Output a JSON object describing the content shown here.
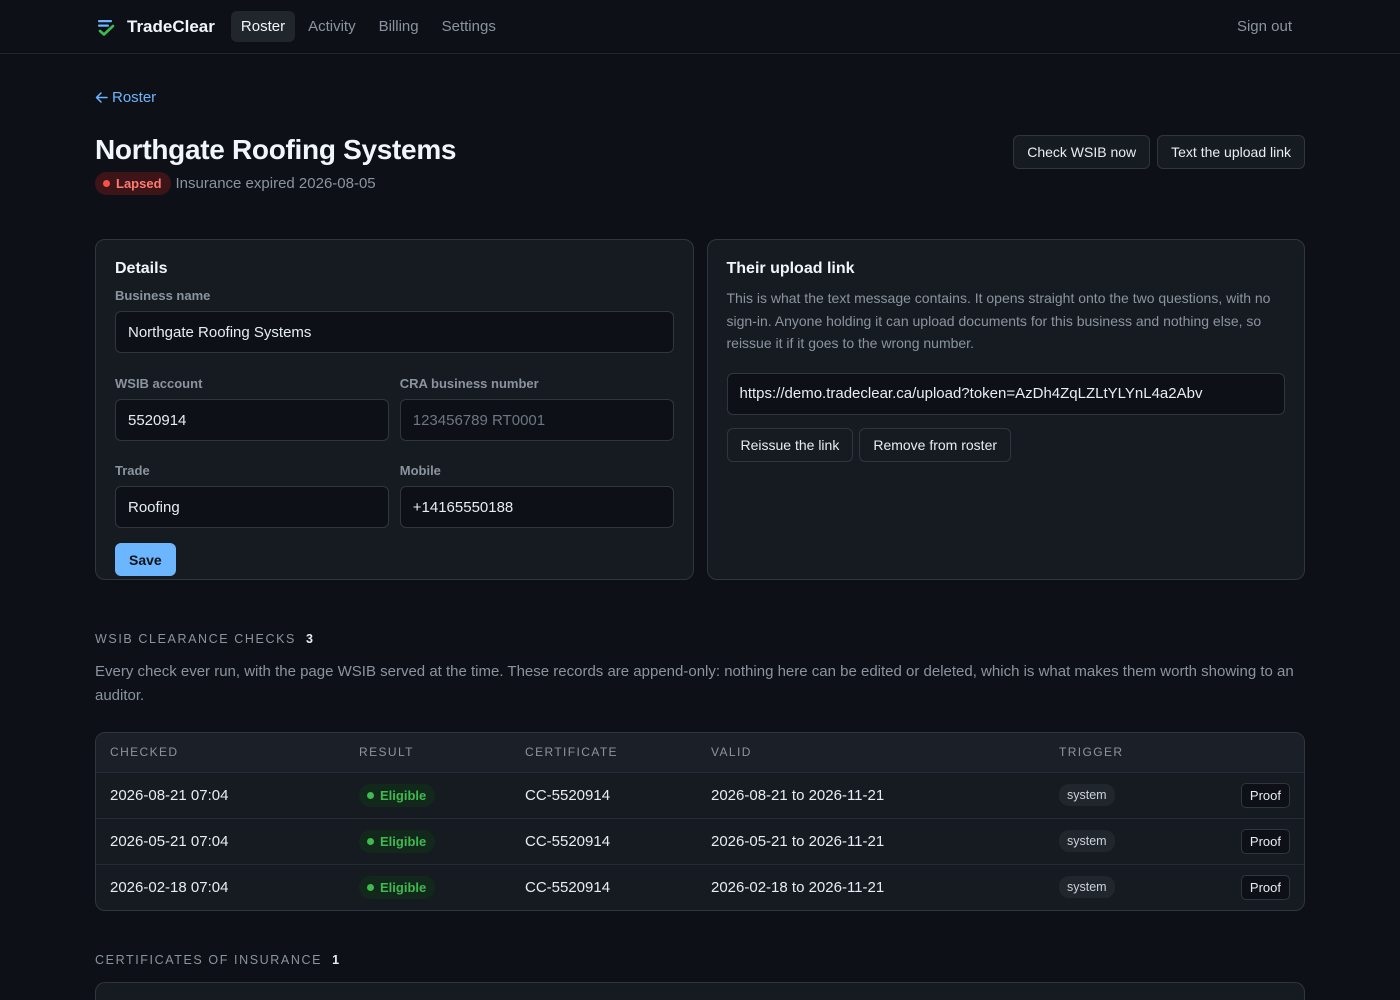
{
  "app": {
    "brand": "TradeClear",
    "nav": [
      "Roster",
      "Activity",
      "Billing",
      "Settings"
    ],
    "sign_out": "Sign out"
  },
  "page": {
    "back_label": "Roster",
    "title": "Northgate Roofing Systems",
    "status_badge": "Lapsed",
    "status_text": "Insurance expired 2026-08-05",
    "actions": [
      "Check WSIB now",
      "Text the upload link"
    ]
  },
  "details": {
    "title": "Details",
    "business_name_label": "Business name",
    "business_name": "Northgate Roofing Systems",
    "wsib_label": "WSIB account",
    "wsib": "5520914",
    "cra_label": "CRA business number",
    "cra_placeholder": "123456789 RT0001",
    "trade_label": "Trade",
    "trade": "Roofing",
    "mobile_label": "Mobile",
    "mobile": "+14165550188",
    "save_label": "Save"
  },
  "upload": {
    "title": "Their upload link",
    "description": "This is what the text message contains. It opens straight onto the two questions, with no sign-in. Anyone holding it can upload documents for this business and nothing else, so reissue it if it goes to the wrong number.",
    "url": "https://demo.tradeclear.ca/upload?token=AzDh4ZqLZLtYLYnL4a2Abv",
    "reissue_label": "Reissue the link",
    "remove_label": "Remove from roster"
  },
  "checks": {
    "heading": "WSIB CLEARANCE CHECKS",
    "count": "3",
    "description": "Every check ever run, with the page WSIB served at the time. These records are append-only: nothing here can be edited or deleted, which is what makes them worth showing to an auditor.",
    "columns": [
      "CHECKED",
      "RESULT",
      "CERTIFICATE",
      "VALID",
      "TRIGGER"
    ],
    "rows": [
      {
        "checked": "2026-08-21 07:04",
        "result": "Eligible",
        "certificate": "CC-5520914",
        "valid": "2026-08-21 to 2026-11-21",
        "trigger": "system",
        "action": "Proof"
      },
      {
        "checked": "2026-05-21 07:04",
        "result": "Eligible",
        "certificate": "CC-5520914",
        "valid": "2026-05-21 to 2026-11-21",
        "trigger": "system",
        "action": "Proof"
      },
      {
        "checked": "2026-02-18 07:04",
        "result": "Eligible",
        "certificate": "CC-5520914",
        "valid": "2026-02-18 to 2026-11-21",
        "trigger": "system",
        "action": "Proof"
      }
    ]
  },
  "insurance": {
    "heading": "CERTIFICATES OF INSURANCE",
    "count": "1"
  },
  "colors": {
    "background": "#0d1117",
    "accent": "#6cb6ff",
    "danger": "#f85149",
    "success": "#3fb950"
  }
}
